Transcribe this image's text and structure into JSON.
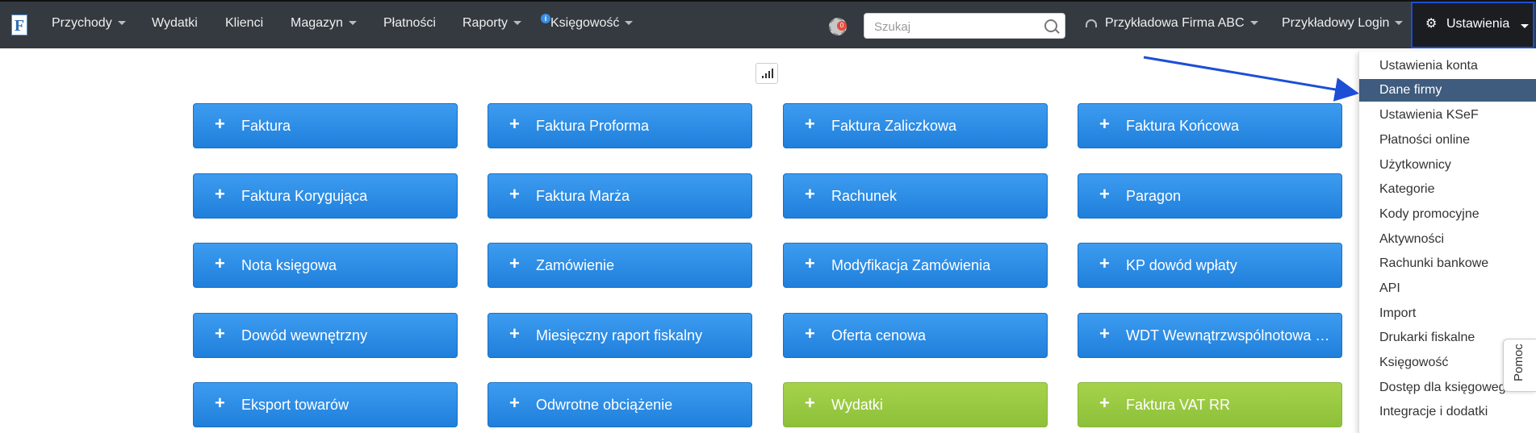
{
  "app": {
    "logo_letter": "F"
  },
  "nav": {
    "items": [
      {
        "label": "Przychody",
        "dropdown": true
      },
      {
        "label": "Wydatki",
        "dropdown": false
      },
      {
        "label": "Klienci",
        "dropdown": false
      },
      {
        "label": "Magazyn",
        "dropdown": true
      },
      {
        "label": "Płatności",
        "dropdown": false
      },
      {
        "label": "Raporty",
        "dropdown": true
      },
      {
        "label": "Księgowość",
        "dropdown": true
      }
    ],
    "info_badge": "i",
    "notification_count": "0",
    "search": {
      "placeholder": "Szukaj",
      "value": ""
    },
    "company": "Przykładowa Firma ABC",
    "login": "Przykładowy Login",
    "settings": "Ustawienia"
  },
  "tiles": [
    {
      "label": "Faktura",
      "color": "blue"
    },
    {
      "label": "Faktura Proforma",
      "color": "blue"
    },
    {
      "label": "Faktura Zaliczkowa",
      "color": "blue"
    },
    {
      "label": "Faktura Końcowa",
      "color": "blue"
    },
    {
      "label": "Faktura Korygująca",
      "color": "blue"
    },
    {
      "label": "Faktura Marża",
      "color": "blue"
    },
    {
      "label": "Rachunek",
      "color": "blue"
    },
    {
      "label": "Paragon",
      "color": "blue"
    },
    {
      "label": "Nota księgowa",
      "color": "blue"
    },
    {
      "label": "Zamówienie",
      "color": "blue"
    },
    {
      "label": "Modyfikacja Zamówienia",
      "color": "blue"
    },
    {
      "label": "KP dowód wpłaty",
      "color": "blue"
    },
    {
      "label": "Dowód wewnętrzny",
      "color": "blue"
    },
    {
      "label": "Miesięczny raport fiskalny",
      "color": "blue"
    },
    {
      "label": "Oferta cenowa",
      "color": "blue"
    },
    {
      "label": "WDT Wewnątrzwspólnotowa Dostawa Towarów",
      "color": "blue"
    },
    {
      "label": "Eksport towarów",
      "color": "blue"
    },
    {
      "label": "Odwrotne obciążenie",
      "color": "blue"
    },
    {
      "label": "Wydatki",
      "color": "green"
    },
    {
      "label": "Faktura VAT RR",
      "color": "green"
    }
  ],
  "settings_menu": {
    "items": [
      {
        "label": "Ustawienia konta",
        "active": false
      },
      {
        "label": "Dane firmy",
        "active": true
      },
      {
        "label": "Ustawienia KSeF",
        "active": false
      },
      {
        "label": "Płatności online",
        "active": false
      },
      {
        "label": "Użytkownicy",
        "active": false
      },
      {
        "label": "Kategorie",
        "active": false
      },
      {
        "label": "Kody promocyjne",
        "active": false
      },
      {
        "label": "Aktywności",
        "active": false
      },
      {
        "label": "Rachunki bankowe",
        "active": false
      },
      {
        "label": "API",
        "active": false
      },
      {
        "label": "Import",
        "active": false
      },
      {
        "label": "Drukarki fiskalne",
        "active": false
      },
      {
        "label": "Księgowość",
        "active": false
      },
      {
        "label": "Dostęp dla księgowego",
        "active": false
      },
      {
        "label": "Integracje i dodatki",
        "active": false
      }
    ]
  },
  "help_tab": "Pomoc",
  "colors": {
    "topbar": "#343a40",
    "tile_blue": "#2a8be6",
    "tile_green": "#9bc944",
    "menu_active": "#3f5b7e",
    "highlight_border": "#1c4fd6",
    "annotation_arrow": "#1c4fd6"
  }
}
